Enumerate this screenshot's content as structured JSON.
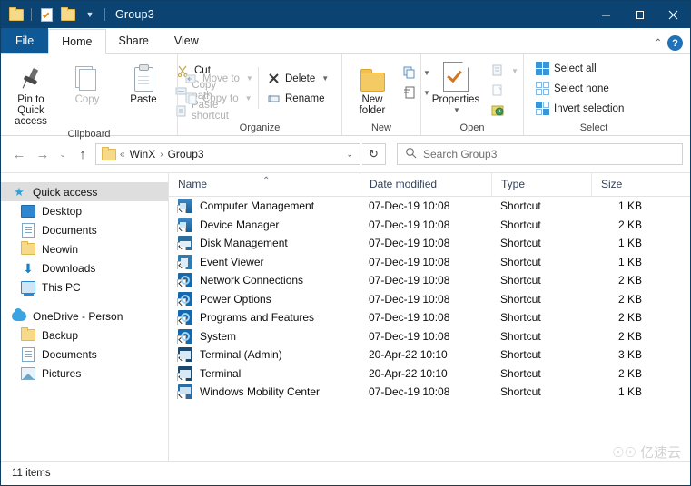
{
  "titlebar": {
    "title": "Group3",
    "qat": [
      {
        "name": "folder-icon",
        "label": "Folder"
      },
      {
        "name": "properties-icon",
        "label": "Properties"
      },
      {
        "name": "new-folder-icon",
        "label": "New folder"
      },
      {
        "name": "chevron-down-icon",
        "label": "Customize Quick Access Toolbar"
      }
    ],
    "minimize": "–",
    "maximize": "☐",
    "close": "✕"
  },
  "tabs": [
    {
      "label": "File",
      "active": false
    },
    {
      "label": "Home",
      "active": true
    },
    {
      "label": "Share",
      "active": false
    },
    {
      "label": "View",
      "active": false
    }
  ],
  "tab_right": {
    "collapse": "⌃",
    "help": "?"
  },
  "ribbon": {
    "clipboard": {
      "label": "Clipboard",
      "pin": "Pin to Quick\naccess",
      "pin_line1": "Pin to Quick",
      "pin_line2": "access",
      "copy": "Copy",
      "paste": "Paste",
      "cut": "Cut",
      "copy_path": "Copy path",
      "paste_shortcut": "Paste shortcut"
    },
    "organize": {
      "label": "Organize",
      "move_to": "Move to",
      "copy_to": "Copy to",
      "delete": "Delete",
      "rename": "Rename"
    },
    "new": {
      "label": "New",
      "new_folder_line1": "New",
      "new_folder_line2": "folder"
    },
    "open": {
      "label": "Open",
      "properties": "Properties"
    },
    "select": {
      "label": "Select",
      "select_all": "Select all",
      "select_none": "Select none",
      "invert_selection": "Invert selection"
    }
  },
  "address": {
    "back": "←",
    "forward": "→",
    "recent": "⌄",
    "up": "↑",
    "crumb_prefix": "«",
    "crumbs": [
      "WinX",
      "Group3"
    ],
    "crumb_sep": "›",
    "dropdown": "⌄",
    "refresh": "↻"
  },
  "search": {
    "icon": "search-icon",
    "placeholder": "Search Group3"
  },
  "sidebar": {
    "items": [
      {
        "label": "Quick access",
        "icon": "star-icon",
        "selected": true,
        "root": true
      },
      {
        "label": "Desktop",
        "icon": "desktop-icon",
        "selected": false,
        "root": false
      },
      {
        "label": "Documents",
        "icon": "documents-icon",
        "selected": false,
        "root": false
      },
      {
        "label": "Neowin",
        "icon": "folder-icon",
        "selected": false,
        "root": false
      },
      {
        "label": "Downloads",
        "icon": "downloads-icon",
        "selected": false,
        "root": false
      },
      {
        "label": "This PC",
        "icon": "this-pc-icon",
        "selected": false,
        "root": false
      },
      {
        "label": "OneDrive - Person",
        "icon": "onedrive-icon",
        "selected": false,
        "root": true
      },
      {
        "label": "Backup",
        "icon": "folder-icon",
        "selected": false,
        "root": false
      },
      {
        "label": "Documents",
        "icon": "documents-icon",
        "selected": false,
        "root": false
      },
      {
        "label": "Pictures",
        "icon": "pictures-icon",
        "selected": false,
        "root": false
      }
    ]
  },
  "columns": [
    {
      "label": "Name",
      "sorted": "asc"
    },
    {
      "label": "Date modified",
      "sorted": ""
    },
    {
      "label": "Type",
      "sorted": ""
    },
    {
      "label": "Size",
      "sorted": ""
    }
  ],
  "sort_caret": "⌃",
  "files": [
    {
      "name": "Computer Management",
      "date": "07-Dec-19 10:08",
      "type": "Shortcut",
      "size": "1 KB",
      "icon": "computer-management-icon"
    },
    {
      "name": "Device Manager",
      "date": "07-Dec-19 10:08",
      "type": "Shortcut",
      "size": "2 KB",
      "icon": "device-manager-icon"
    },
    {
      "name": "Disk Management",
      "date": "07-Dec-19 10:08",
      "type": "Shortcut",
      "size": "1 KB",
      "icon": "disk-management-icon"
    },
    {
      "name": "Event Viewer",
      "date": "07-Dec-19 10:08",
      "type": "Shortcut",
      "size": "1 KB",
      "icon": "event-viewer-icon"
    },
    {
      "name": "Network Connections",
      "date": "07-Dec-19 10:08",
      "type": "Shortcut",
      "size": "2 KB",
      "icon": "network-connections-icon"
    },
    {
      "name": "Power Options",
      "date": "07-Dec-19 10:08",
      "type": "Shortcut",
      "size": "2 KB",
      "icon": "power-options-icon"
    },
    {
      "name": "Programs and Features",
      "date": "07-Dec-19 10:08",
      "type": "Shortcut",
      "size": "2 KB",
      "icon": "programs-features-icon"
    },
    {
      "name": "System",
      "date": "07-Dec-19 10:08",
      "type": "Shortcut",
      "size": "2 KB",
      "icon": "system-icon"
    },
    {
      "name": "Terminal (Admin)",
      "date": "20-Apr-22 10:10",
      "type": "Shortcut",
      "size": "3 KB",
      "icon": "terminal-admin-icon"
    },
    {
      "name": "Terminal",
      "date": "20-Apr-22 10:10",
      "type": "Shortcut",
      "size": "2 KB",
      "icon": "terminal-icon"
    },
    {
      "name": "Windows Mobility Center",
      "date": "07-Dec-19 10:08",
      "type": "Shortcut",
      "size": "1 KB",
      "icon": "mobility-center-icon"
    }
  ],
  "status": {
    "items": "11 items"
  },
  "watermark": {
    "text": "亿速云",
    "icon": "☉☉"
  }
}
